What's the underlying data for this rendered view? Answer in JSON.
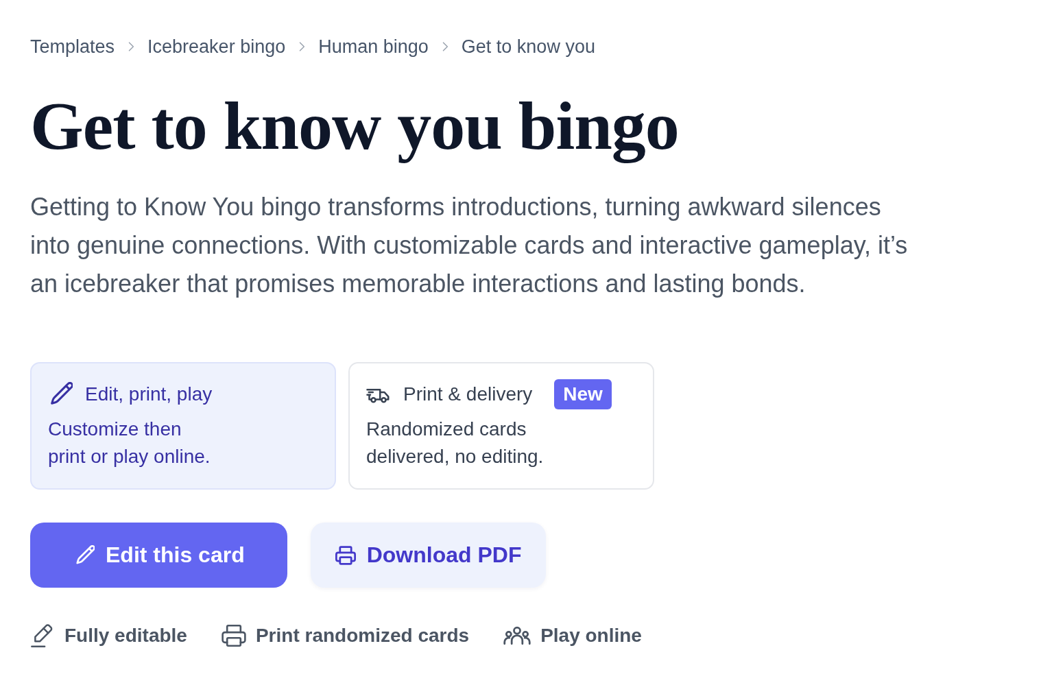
{
  "breadcrumb": [
    {
      "label": "Templates"
    },
    {
      "label": "Icebreaker bingo"
    },
    {
      "label": "Human bingo"
    },
    {
      "label": "Get to know you"
    }
  ],
  "title": "Get to know you bingo",
  "description": "Getting to Know You bingo transforms introductions, turning awkward silences into genuine connections. With customizable cards and interactive gameplay, it’s an icebreaker that promises memorable interactions and lasting bonds.",
  "options": [
    {
      "title": "Edit, print, play",
      "text": "Customize then print or play online.",
      "selected": true
    },
    {
      "title": "Print & delivery",
      "badge": "New",
      "text": "Randomized cards delivered, no editing.",
      "selected": false
    }
  ],
  "buttons": [
    {
      "label": "Edit this card",
      "kind": "primary"
    },
    {
      "label": "Download PDF",
      "kind": "secondary"
    }
  ],
  "features": [
    {
      "label": "Fully editable"
    },
    {
      "label": "Print randomized cards"
    },
    {
      "label": "Play online"
    }
  ]
}
